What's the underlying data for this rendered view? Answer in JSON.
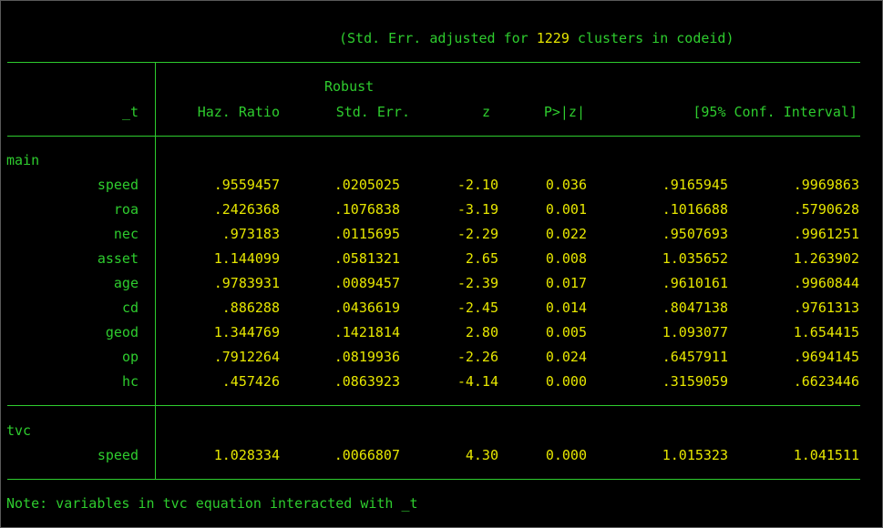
{
  "header_note_pre": "(Std. Err. adjusted for ",
  "header_note_num": "1229",
  "header_note_post": " clusters in codeid)",
  "col_headers": {
    "t": "_t",
    "haz_ratio": "Haz. Ratio",
    "robust": "Robust",
    "std_err": "Std. Err.",
    "z": "z",
    "p": "P>|z|",
    "ci": "[95% Conf. Interval]"
  },
  "groups": [
    {
      "name": "main",
      "rows": [
        {
          "var": "speed",
          "hr": ".9559457",
          "se": ".0205025",
          "z": "-2.10",
          "p": "0.036",
          "lo": ".9165945",
          "hi": ".9969863"
        },
        {
          "var": "roa",
          "hr": ".2426368",
          "se": ".1076838",
          "z": "-3.19",
          "p": "0.001",
          "lo": ".1016688",
          "hi": ".5790628"
        },
        {
          "var": "nec",
          "hr": ".973183",
          "se": ".0115695",
          "z": "-2.29",
          "p": "0.022",
          "lo": ".9507693",
          "hi": ".9961251"
        },
        {
          "var": "asset",
          "hr": "1.144099",
          "se": ".0581321",
          "z": "2.65",
          "p": "0.008",
          "lo": "1.035652",
          "hi": "1.263902"
        },
        {
          "var": "age",
          "hr": ".9783931",
          "se": ".0089457",
          "z": "-2.39",
          "p": "0.017",
          "lo": ".9610161",
          "hi": ".9960844"
        },
        {
          "var": "cd",
          "hr": ".886288",
          "se": ".0436619",
          "z": "-2.45",
          "p": "0.014",
          "lo": ".8047138",
          "hi": ".9761313"
        },
        {
          "var": "geod",
          "hr": "1.344769",
          "se": ".1421814",
          "z": "2.80",
          "p": "0.005",
          "lo": "1.093077",
          "hi": "1.654415"
        },
        {
          "var": "op",
          "hr": ".7912264",
          "se": ".0819936",
          "z": "-2.26",
          "p": "0.024",
          "lo": ".6457911",
          "hi": ".9694145"
        },
        {
          "var": "hc",
          "hr": ".457426",
          "se": ".0863923",
          "z": "-4.14",
          "p": "0.000",
          "lo": ".3159059",
          "hi": ".6623446"
        }
      ]
    },
    {
      "name": "tvc",
      "rows": [
        {
          "var": "speed",
          "hr": "1.028334",
          "se": ".0066807",
          "z": "4.30",
          "p": "0.000",
          "lo": "1.015323",
          "hi": "1.041511"
        }
      ]
    }
  ],
  "footer_note": "Note: variables in tvc equation interacted with _t",
  "colors": {
    "green": "#2ecc2e",
    "yellow": "#e6e600",
    "background": "#000000"
  }
}
